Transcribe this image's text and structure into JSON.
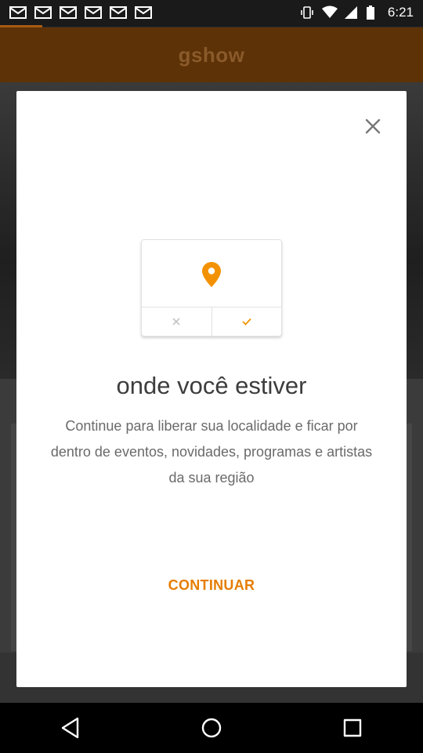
{
  "status_bar": {
    "time": "6:21",
    "left_icons": [
      "mail-icon",
      "mail-icon",
      "mail-icon",
      "mail-icon",
      "mail-icon",
      "mail-icon"
    ],
    "right_icons": [
      "vibrate-icon",
      "wifi-icon",
      "cellular-icon",
      "battery-icon"
    ]
  },
  "app": {
    "logo": "gshow",
    "accent_color": "#e57d00",
    "header_color": "#5d3207"
  },
  "dialog": {
    "title": "onde você estiver",
    "description": "Continue para liberar sua localidade e ficar por dentro de eventos, novidades, programas e artistas da sua região",
    "continue_label": "CONTINUAR",
    "close_icon": "close-icon",
    "illustration": {
      "pin_icon": "location-pin-icon",
      "deny_icon": "x-icon",
      "allow_icon": "check-icon"
    }
  },
  "nav_bar": {
    "buttons": [
      "back-icon",
      "home-icon",
      "recents-icon"
    ]
  }
}
